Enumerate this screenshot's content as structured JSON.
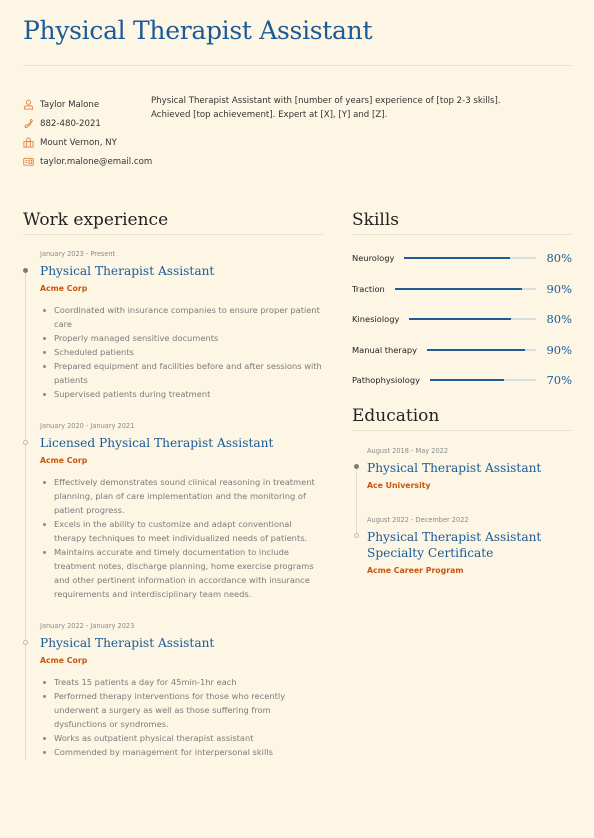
{
  "header": {
    "title": "Physical Therapist Assistant"
  },
  "contact": {
    "items": [
      {
        "icon": "person-icon",
        "text": "Taylor Malone"
      },
      {
        "icon": "phone-icon",
        "text": "882-480-2021"
      },
      {
        "icon": "location-icon",
        "text": "Mount Vernon, NY"
      },
      {
        "icon": "email-icon",
        "text": "taylor.malone@email.com"
      }
    ]
  },
  "summary": "Physical Therapist Assistant with [number of years] experience of [top 2-3 skills]. Achieved [top achievement]. Expert at [X], [Y] and [Z].",
  "colors": {
    "accent": "#1a5a96",
    "org": "#c8570d",
    "background": "#fdf6e5",
    "icon": "#e0843f"
  },
  "work": {
    "heading": "Work experience",
    "entries": [
      {
        "date": "January 2023 - Present",
        "role": "Physical Therapist Assistant",
        "org": "Acme Corp",
        "bullets": [
          "Coordinated with insurance companies to ensure proper patient care",
          "Properly managed sensitive documents",
          "Scheduled patients",
          "Prepared equipment and facilities before and after sessions with patients",
          "Supervised patients during treatment"
        ]
      },
      {
        "date": "January 2020 - January 2021",
        "role": "Licensed Physical Therapist Assistant",
        "org": "Acme Corp",
        "bullets": [
          "Effectively demonstrates sound clinical reasoning in treatment planning, plan of care implementation and the monitoring of patient progress.",
          "Excels in the ability to customize and adapt conventional therapy techniques to meet individualized needs of patients.",
          "Maintains accurate and timely documentation to include treatment notes, discharge planning, home exercise programs and other pertinent information in accordance with insurance requirements and interdisciplinary team needs."
        ]
      },
      {
        "date": "January 2022 - January 2023",
        "role": "Physical Therapist Assistant",
        "org": "Acme Corp",
        "bullets": [
          "Treats 15 patients a day for 45min-1hr each",
          "Performed therapy interventions for those who recently underwent a surgery as well as those suffering from dysfunctions or syndromes.",
          "Works as outpatient physical therapist assistant",
          "Commended by management for interpersonal skills"
        ]
      }
    ]
  },
  "skills": {
    "heading": "Skills",
    "items": [
      {
        "name": "Neurology",
        "label": "80%",
        "level": 0.8
      },
      {
        "name": "Traction",
        "label": "90%",
        "level": 0.9
      },
      {
        "name": "Kinesiology",
        "label": "80%",
        "level": 0.8
      },
      {
        "name": "Manual therapy",
        "label": "90%",
        "level": 0.9
      },
      {
        "name": "Pathophysiology",
        "label": "70%",
        "level": 0.7
      }
    ]
  },
  "education": {
    "heading": "Education",
    "entries": [
      {
        "date": "August 2018 - May 2022",
        "role": "Physical Therapist Assistant",
        "org": "Ace University"
      },
      {
        "date": "August 2022 - December 2022",
        "role": "Physical Therapist Assistant Specialty Certificate",
        "org": "Acme Career Program"
      }
    ]
  }
}
